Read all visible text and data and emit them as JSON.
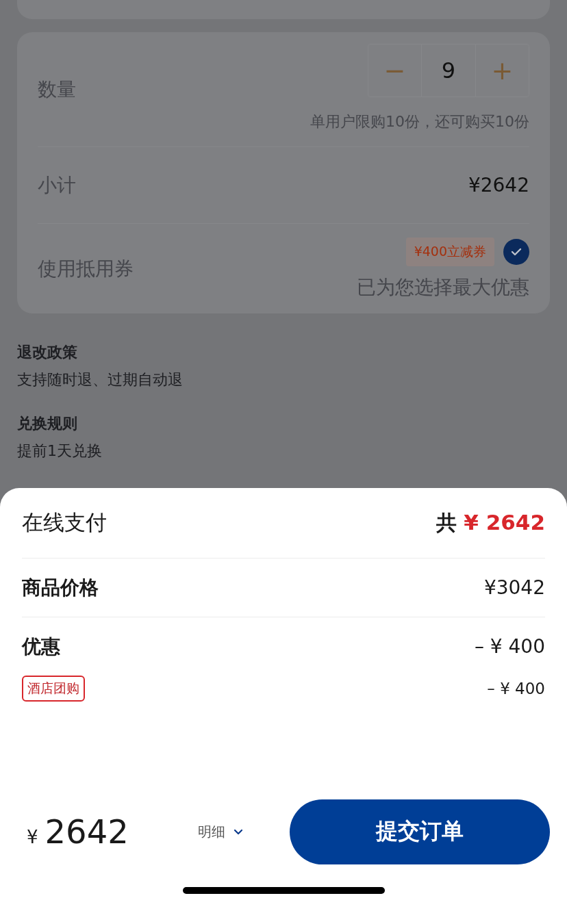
{
  "quantity": {
    "label": "数量",
    "minus": "−",
    "value": "9",
    "plus": "+",
    "limit_note": "单用户限购10份，还可购买10份"
  },
  "subtotal": {
    "label": "小计",
    "value": "¥2642"
  },
  "coupon": {
    "label": "使用抵用券",
    "tag": "¥400立减券",
    "checked": true,
    "note": "已为您选择最大优惠"
  },
  "policies": [
    {
      "title": "退改政策",
      "text": "支持随时退、过期自动退"
    },
    {
      "title": "兑换规则",
      "text": "提前1天兑换"
    }
  ],
  "sheet": {
    "title": "在线支付",
    "total_prefix": "共",
    "total": "¥ 2642",
    "rows": [
      {
        "label": "商品价格",
        "value": "¥3042"
      },
      {
        "label": "优惠",
        "value": "– ¥ 400"
      }
    ],
    "discount_items": [
      {
        "tag": "酒店团购",
        "value": "– ¥ 400"
      }
    ]
  },
  "footer": {
    "currency": "¥",
    "amount": "2642",
    "details": "明细",
    "expanded": false,
    "submit": "提交订单"
  }
}
